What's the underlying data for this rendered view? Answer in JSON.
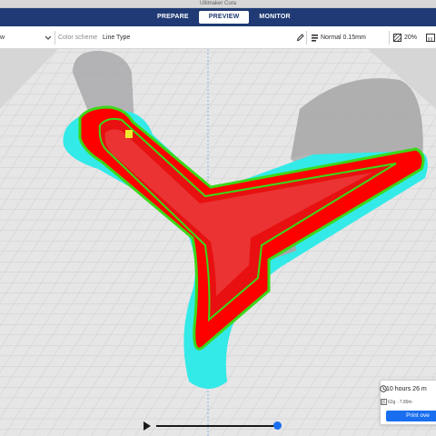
{
  "window": {
    "title": "Ultimaker Cura"
  },
  "stages": [
    {
      "label": "PREPARE"
    },
    {
      "label": "PREVIEW"
    },
    {
      "label": "MONITOR"
    }
  ],
  "toolbar": {
    "view_fragment": "w",
    "color_scheme_label": "Color scheme",
    "color_scheme_value": "Line Type",
    "profile": "Normal 0.15mm",
    "infill": "20%"
  },
  "estimate": {
    "time": "10 hours 26 m",
    "material": "62g · 7.89m",
    "button": "Print ove"
  },
  "colors": {
    "app_bar": "#1f3a74",
    "accent": "#196ef0",
    "wall_outer": "#ff0000",
    "wall_inner": "#3cd818",
    "support": "#2ef0ee",
    "skirt": "#33eae8",
    "infill": "#f1ea2c",
    "model_ghost": "#a9a9ab"
  },
  "icons": [
    "chevron-down-icon",
    "pencil-icon",
    "profile-icon",
    "infill-icon",
    "support-icon",
    "clock-icon",
    "spool-icon",
    "play-icon"
  ]
}
